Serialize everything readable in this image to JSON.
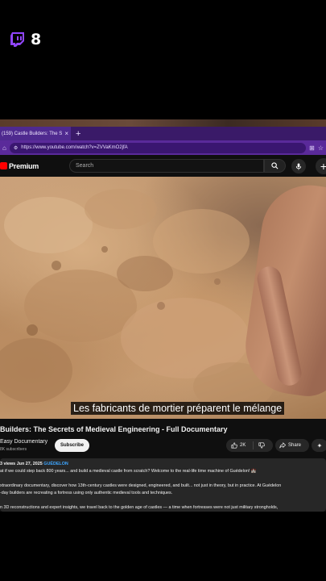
{
  "overlay": {
    "count": "8"
  },
  "browser": {
    "tab_title": "(159) Castle Builders: The S",
    "tab_close": "×",
    "new_tab": "+",
    "url": "https://www.youtube.com/watch?v=ZVVaKmO2jfA"
  },
  "youtube": {
    "brand": "Premium",
    "search_placeholder": "Search",
    "create": "+"
  },
  "video": {
    "subtitle": "Les fabricants de mortier préparent le mélange"
  },
  "watch": {
    "title": "Builders: The Secrets of Medieval Engineering - Full Documentary",
    "channel": "Easy Documentary",
    "subscribers": "8K subscribers",
    "subscribe": "Subscribe",
    "likes": "2K",
    "share": "Share"
  },
  "description": {
    "views": "3 views",
    "date": "Jun 27, 2025",
    "tag": "GUÉDELON",
    "line1": "at if we could step back 800 years... and build a medieval castle from scratch? Welcome to the real-life time machine of Guédelon! 🏰",
    "line2": "xtraordinary documentary, discover how 13th-century castles were designed, engineered, and built... not just in theory, but in practice. At Guédelon",
    "line3": "-day builders are recreating a fortress using only authentic medieval tools and techniques.",
    "line4": "n 3D reconstructions and expert insights, we travel back to the golden age of castles — a time when fortresses were not just military strongholds,"
  },
  "colors": {
    "accent": "#9146ff",
    "tab_bar": "#3a1a68",
    "youtube_red": "#ff0000"
  }
}
